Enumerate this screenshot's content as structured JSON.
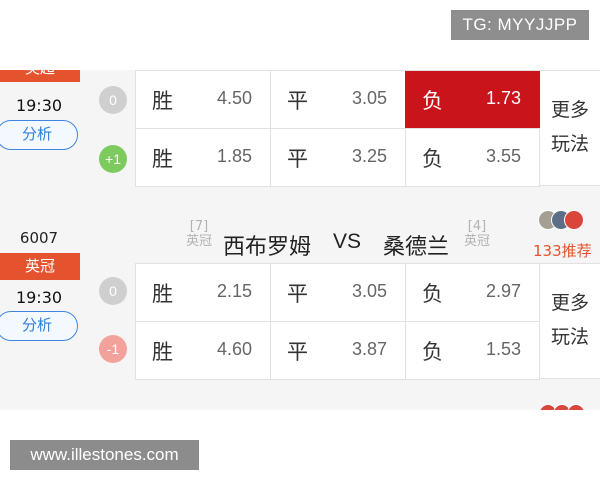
{
  "watermarks": {
    "top": "TG: MYYJJPP",
    "bottom": "www.illestones.com"
  },
  "outcomes": {
    "win": "胜",
    "draw": "平",
    "lose": "负"
  },
  "more_label": [
    "更多",
    "玩法"
  ],
  "colors": {
    "accent_red": "#c8141a",
    "league_orange": "#e5532e",
    "link_blue": "#2f7fdc"
  },
  "matches": [
    {
      "league": "英超",
      "time": "19:30",
      "analysis_label": "分析",
      "rows": [
        {
          "handicap": "0",
          "win": "4.50",
          "draw": "3.05",
          "lose": "1.73",
          "selected": "lose"
        },
        {
          "handicap": "+1",
          "win": "1.85",
          "draw": "3.25",
          "lose": "3.55"
        }
      ]
    },
    {
      "code": "6007",
      "league": "英冠",
      "time": "19:30",
      "analysis_label": "分析",
      "home": {
        "rank": "[7]",
        "league": "英冠",
        "name": "西布罗姆"
      },
      "vs": "VS",
      "away": {
        "rank": "[4]",
        "league": "英冠",
        "name": "桑德兰"
      },
      "recommend": "133推荐",
      "rows": [
        {
          "handicap": "0",
          "win": "2.15",
          "draw": "3.05",
          "lose": "2.97"
        },
        {
          "handicap": "-1",
          "win": "4.60",
          "draw": "3.87",
          "lose": "1.53"
        }
      ]
    }
  ]
}
